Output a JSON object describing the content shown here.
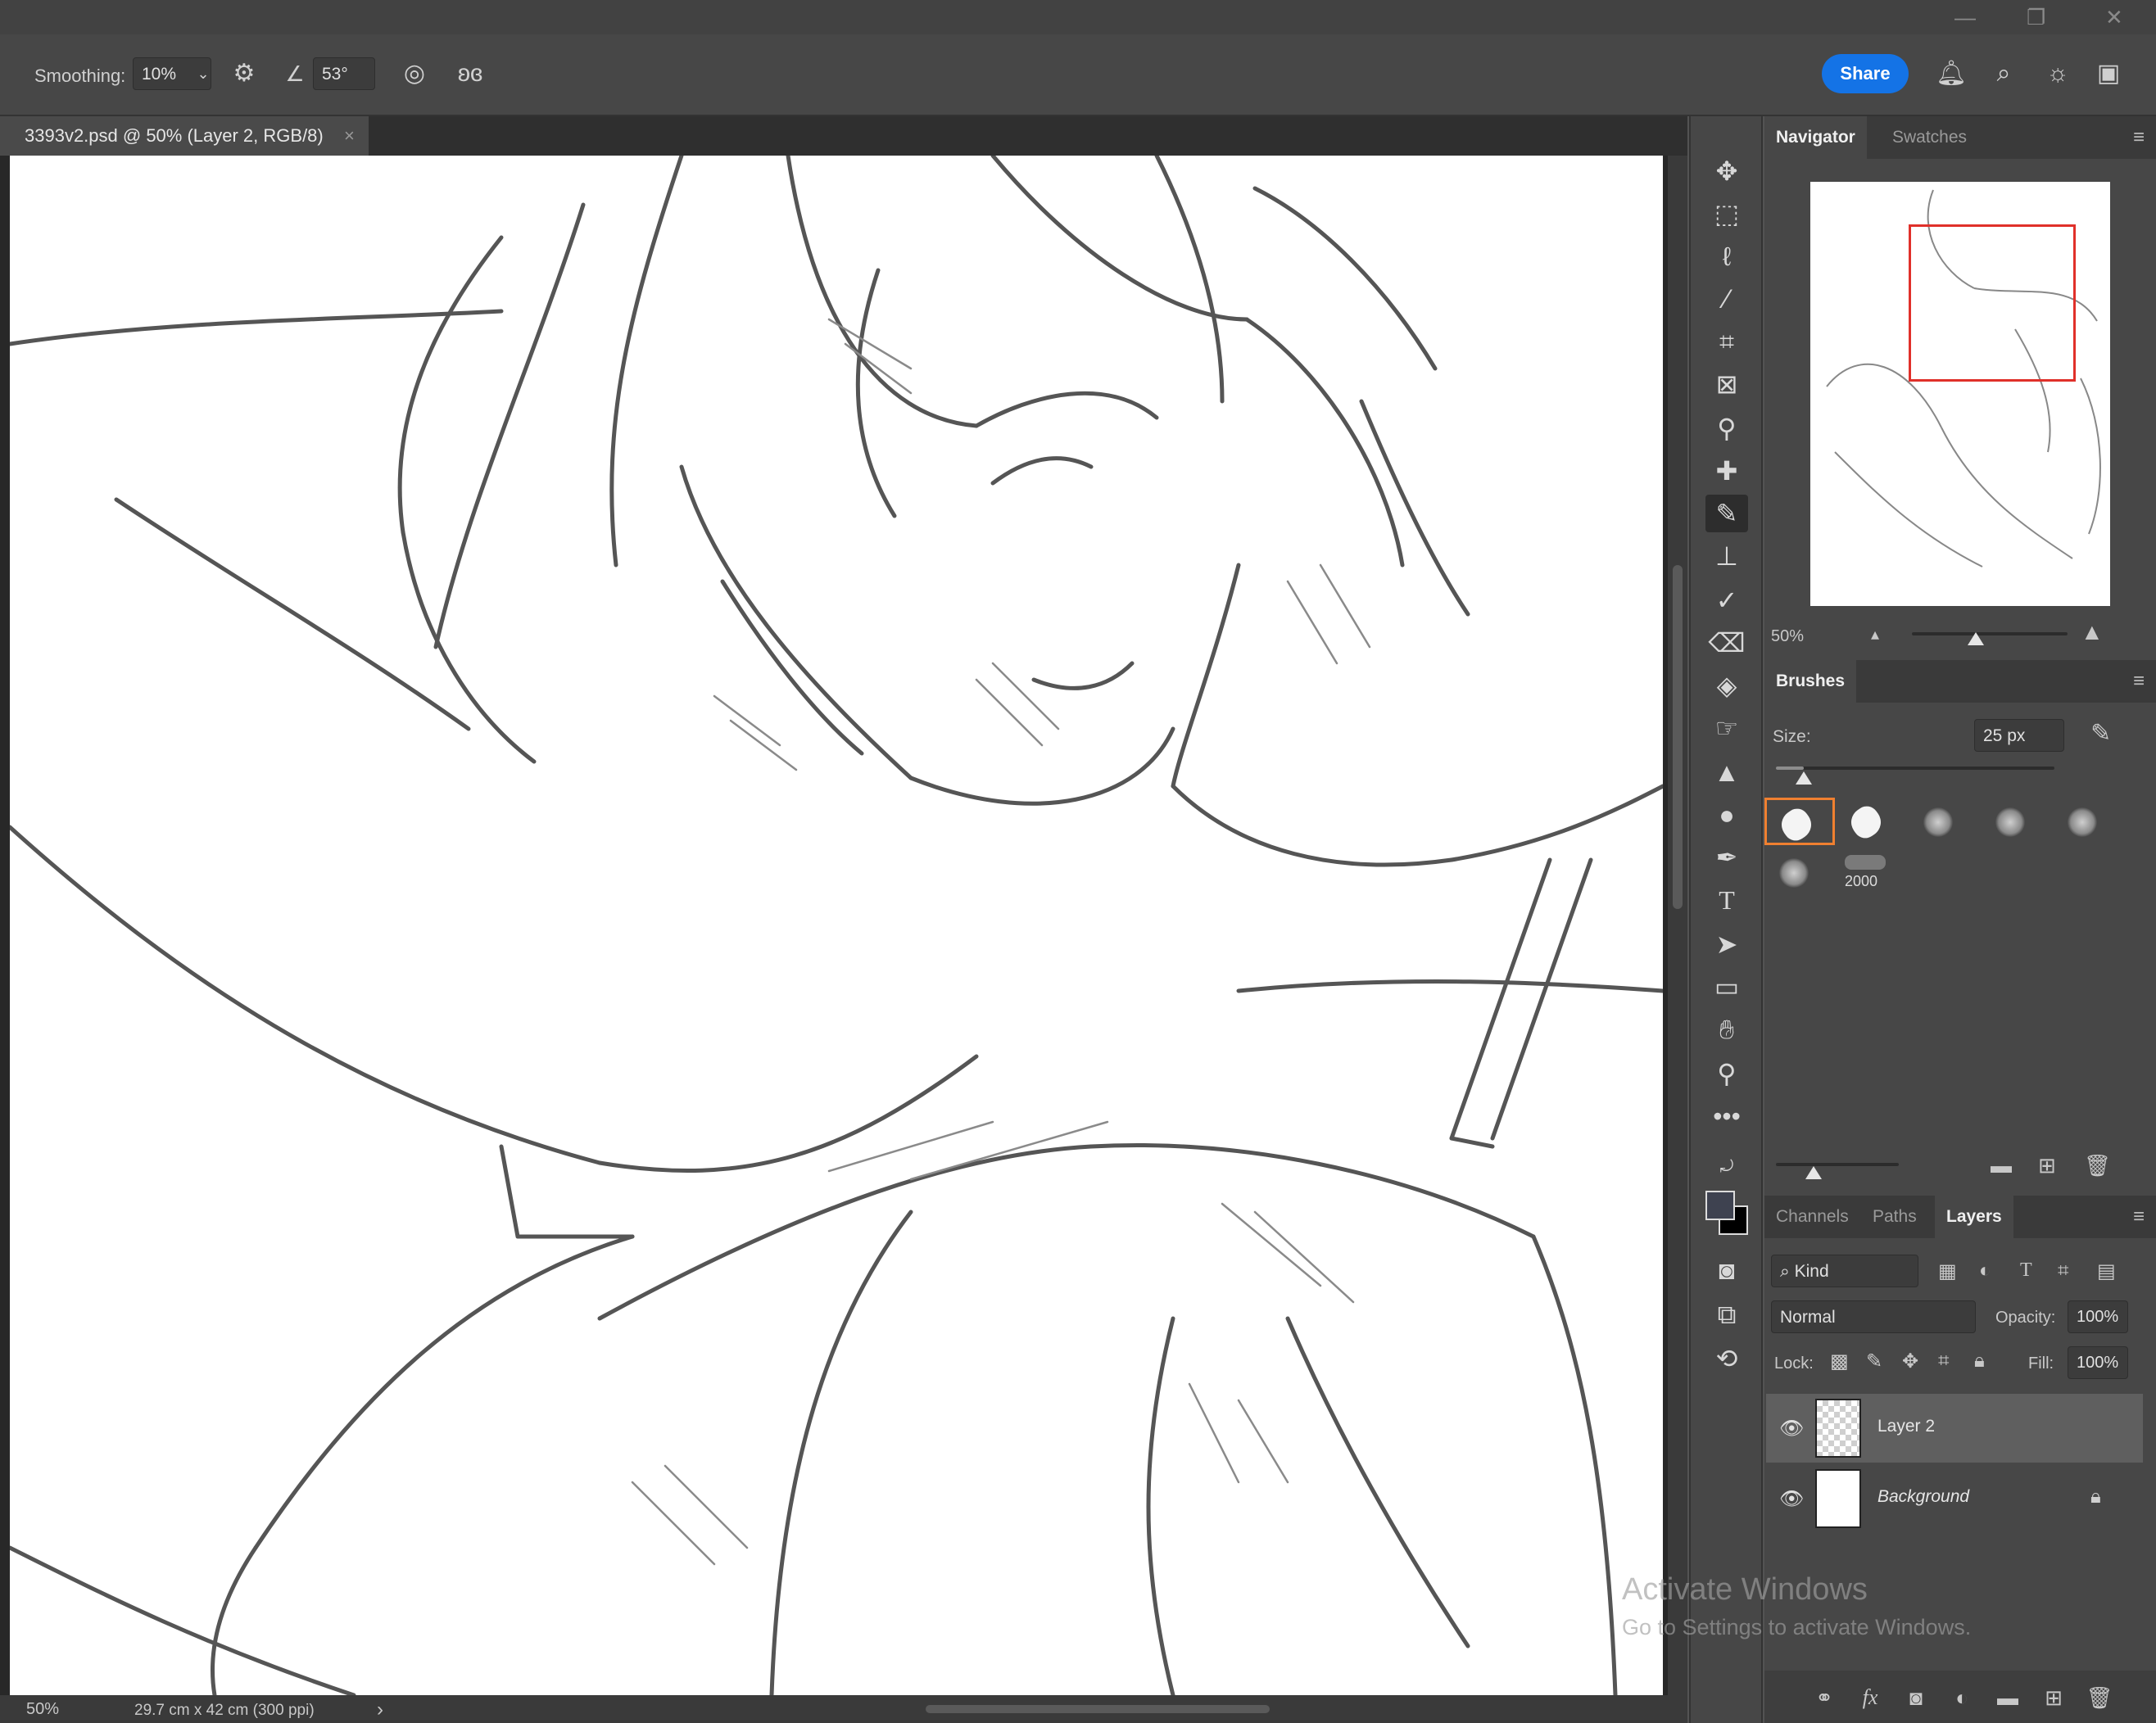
{
  "window": {
    "minimize": "—",
    "restore": "❐",
    "close": "✕"
  },
  "options": {
    "smoothing_label": "Smoothing:",
    "smoothing_value": "10%",
    "angle_value": "53°",
    "share_label": "Share"
  },
  "document": {
    "tab_title": "3393v2.psd @ 50% (Layer 2, RGB/8)",
    "tab_close": "×"
  },
  "status": {
    "zoom": "50%",
    "doc_size": "29.7 cm x 42 cm (300 ppi)",
    "arrow": "›"
  },
  "navigator": {
    "tabs": [
      "Navigator",
      "Swatches"
    ],
    "zoom": "50%"
  },
  "brushes": {
    "title": "Brushes",
    "size_label": "Size:",
    "size_value": "25 px",
    "size_fraction": 0.1,
    "preset_count_label": "2000"
  },
  "layers_panel": {
    "tabs": [
      "Channels",
      "Paths",
      "Layers"
    ],
    "filter_kind": "Kind",
    "blend_mode": "Normal",
    "opacity_label": "Opacity:",
    "opacity_value": "100%",
    "lock_label": "Lock:",
    "fill_label": "Fill:",
    "fill_value": "100%",
    "layers": [
      {
        "name": "Layer 2",
        "selected": true
      },
      {
        "name": "Background",
        "selected": false,
        "locked": true
      }
    ]
  },
  "watermark": {
    "line1": "Activate Windows",
    "line2": "Go to Settings to activate Windows."
  },
  "icons": {
    "tools": [
      "move-icon",
      "marquee-icon",
      "lasso-icon",
      "magic-wand-icon",
      "crop-icon",
      "frame-icon",
      "eyedropper-icon",
      "healing-brush-icon",
      "brush-icon",
      "clone-stamp-icon",
      "history-brush-icon",
      "eraser-icon",
      "paint-bucket-icon",
      "smudge-icon",
      "sharpen-icon",
      "dodge-icon",
      "pen-icon",
      "type-icon",
      "path-selection-icon",
      "rectangle-icon",
      "hand-icon",
      "zoom-icon",
      "more-icon"
    ]
  },
  "colors": {
    "accent": "#1473e6",
    "navigator_box": "#e0302a",
    "selected_brush": "#f08030",
    "foreground": "#3e4250",
    "background": "#000000"
  }
}
